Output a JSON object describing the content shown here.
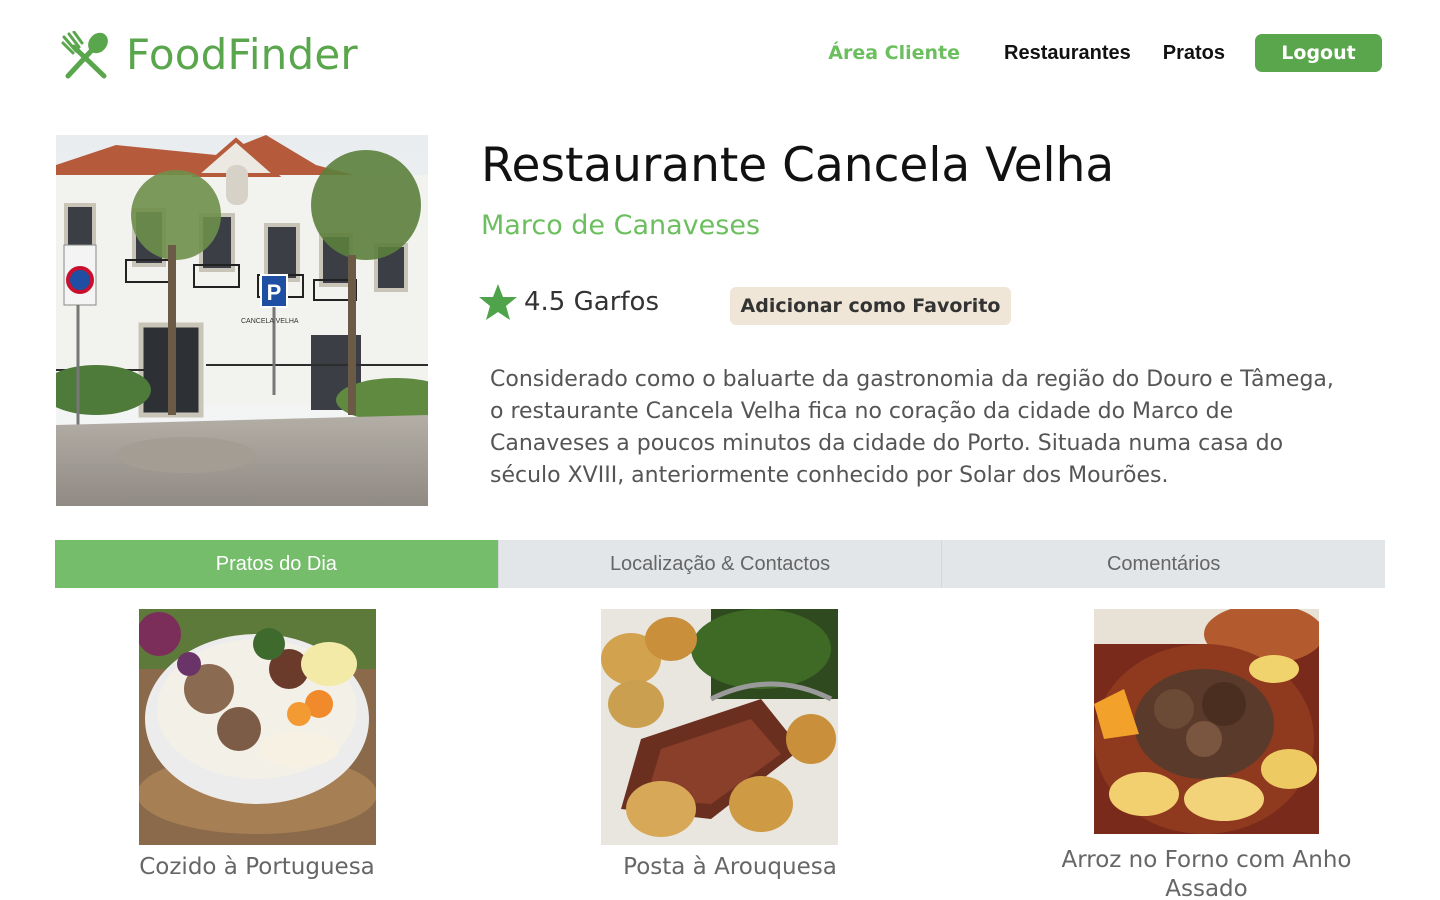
{
  "header": {
    "brand": "FoodFinder",
    "nav": {
      "client_area": "Área Cliente",
      "restaurants": "Restaurantes",
      "dishes": "Pratos",
      "logout": "Logout"
    }
  },
  "restaurant": {
    "name": "Restaurante Cancela Velha",
    "city": "Marco de Canaveses",
    "rating": "4.5 Garfos",
    "favorite_button": "Adicionar como Favorito",
    "description": "Considerado como o baluarte da gastronomia da região do Douro e Tâmega, o restaurante Cancela Velha fica no coração da cidade do Marco de Canaveses a poucos minutos da cidade do Porto. Situada numa casa do século XVIII, anteriormente conhecido por Solar dos Mourões.",
    "photo_signs": {
      "parking": "P",
      "plaque": "CANCELA VELHA"
    }
  },
  "tabs": [
    {
      "label": "Pratos do Dia",
      "active": true
    },
    {
      "label": "Localização & Contactos",
      "active": false
    },
    {
      "label": "Comentários",
      "active": false
    }
  ],
  "dishes": [
    {
      "name": "Cozido à Portuguesa"
    },
    {
      "name": "Posta à Arouquesa"
    },
    {
      "name": "Arroz no Forno com Anho Assado"
    }
  ],
  "colors": {
    "brand_green": "#5aa64c",
    "accent_green": "#6cbf5e",
    "tab_active": "#75bd6b",
    "tab_inactive": "#e3e6e9",
    "favorite_bg": "#efe6d7"
  }
}
